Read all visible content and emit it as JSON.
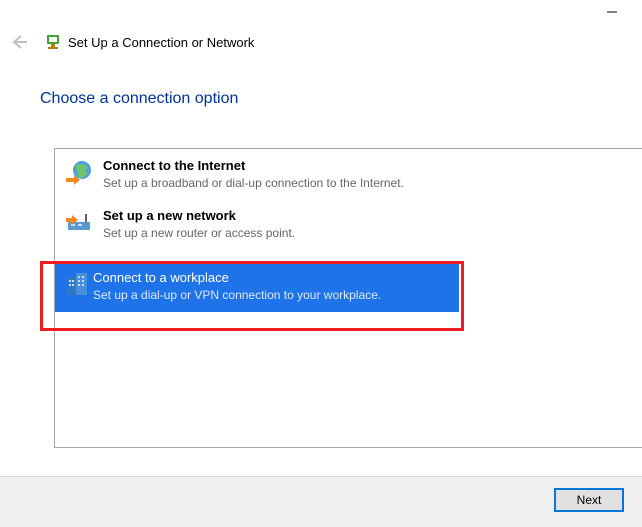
{
  "window": {
    "title": "Set Up a Connection or Network"
  },
  "heading": "Choose a connection option",
  "options": [
    {
      "title": "Connect to the Internet",
      "desc": "Set up a broadband or dial-up connection to the Internet."
    },
    {
      "title": "Set up a new network",
      "desc": "Set up a new router or access point."
    },
    {
      "title": "Connect to a workplace",
      "desc": "Set up a dial-up or VPN connection to your workplace."
    }
  ],
  "buttons": {
    "next": "Next"
  }
}
